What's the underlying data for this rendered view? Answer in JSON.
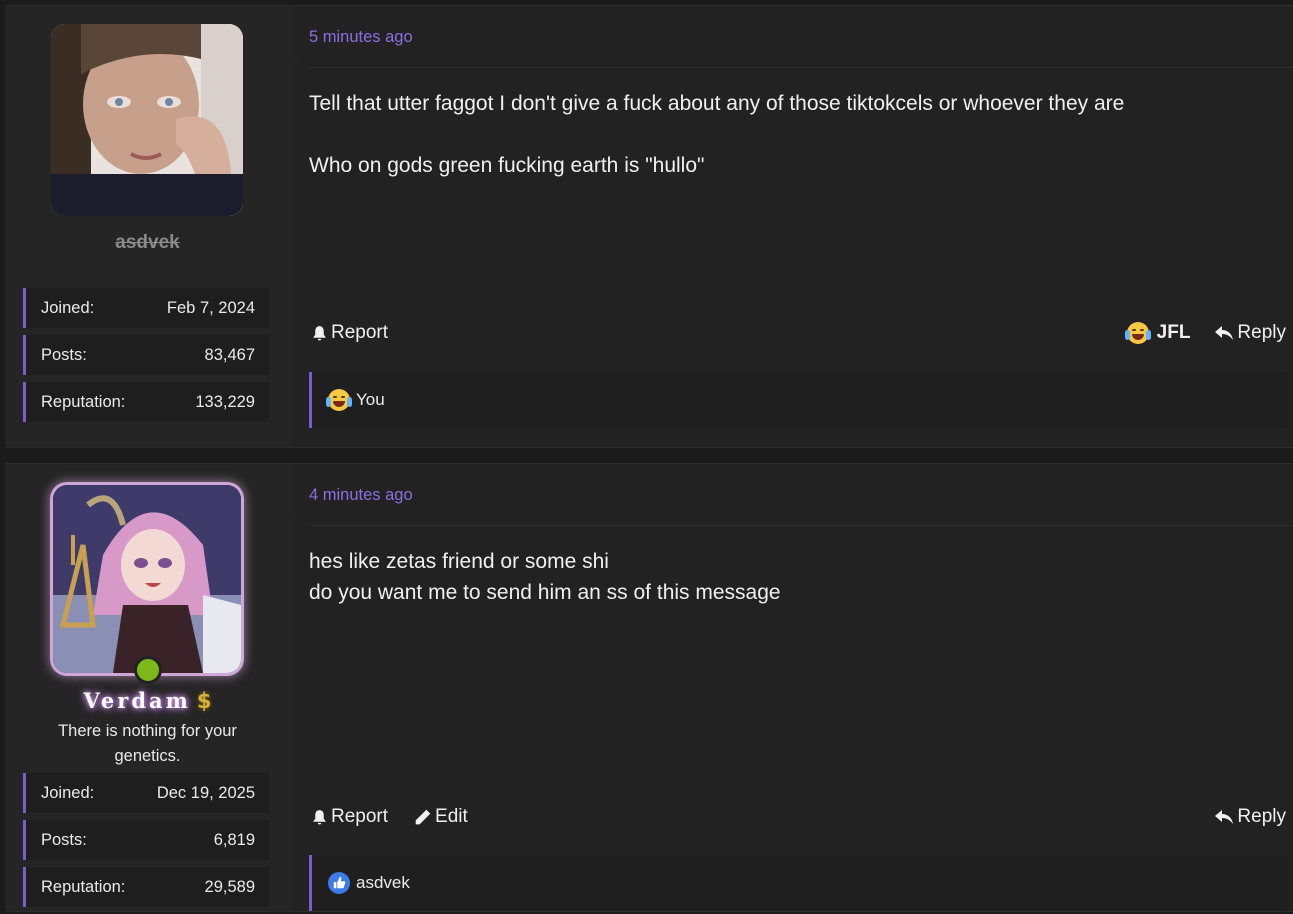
{
  "posts": [
    {
      "username": "asdvek",
      "stats": [
        {
          "label": "Joined:",
          "value": "Feb 7, 2024"
        },
        {
          "label": "Posts:",
          "value": "83,467"
        },
        {
          "label": "Reputation:",
          "value": "133,229"
        }
      ],
      "timestamp": "5 minutes ago",
      "body": [
        "Tell that utter faggot I don't give a fuck about any of those tiktokcels or whoever they are",
        "Who on gods green fucking earth is \"hullo\""
      ],
      "actions": {
        "report": "Report",
        "reaction": "JFL",
        "reply": "Reply"
      },
      "reaction_summary": {
        "icon": "crying-laughing-emoji",
        "text": "You"
      }
    },
    {
      "username": "Verdam",
      "username_badge": "$",
      "user_title": "There is nothing for your genetics.",
      "online": true,
      "stats": [
        {
          "label": "Joined:",
          "value": "Dec 19, 2025"
        },
        {
          "label": "Posts:",
          "value": "6,819"
        },
        {
          "label": "Reputation:",
          "value": "29,589"
        }
      ],
      "timestamp": "4 minutes ago",
      "body": [
        "hes like zetas friend or some shi",
        "do you want me to send him an ss of this message"
      ],
      "actions": {
        "report": "Report",
        "edit": "Edit",
        "reply": "Reply"
      },
      "reaction_summary": {
        "icon": "thumbs-up-icon",
        "text": "asdvek"
      }
    }
  ],
  "colors": {
    "accent": "#7b5ccf",
    "timestamp": "#8a6fe0",
    "online": "#7db81a",
    "like": "#3d7be8"
  }
}
